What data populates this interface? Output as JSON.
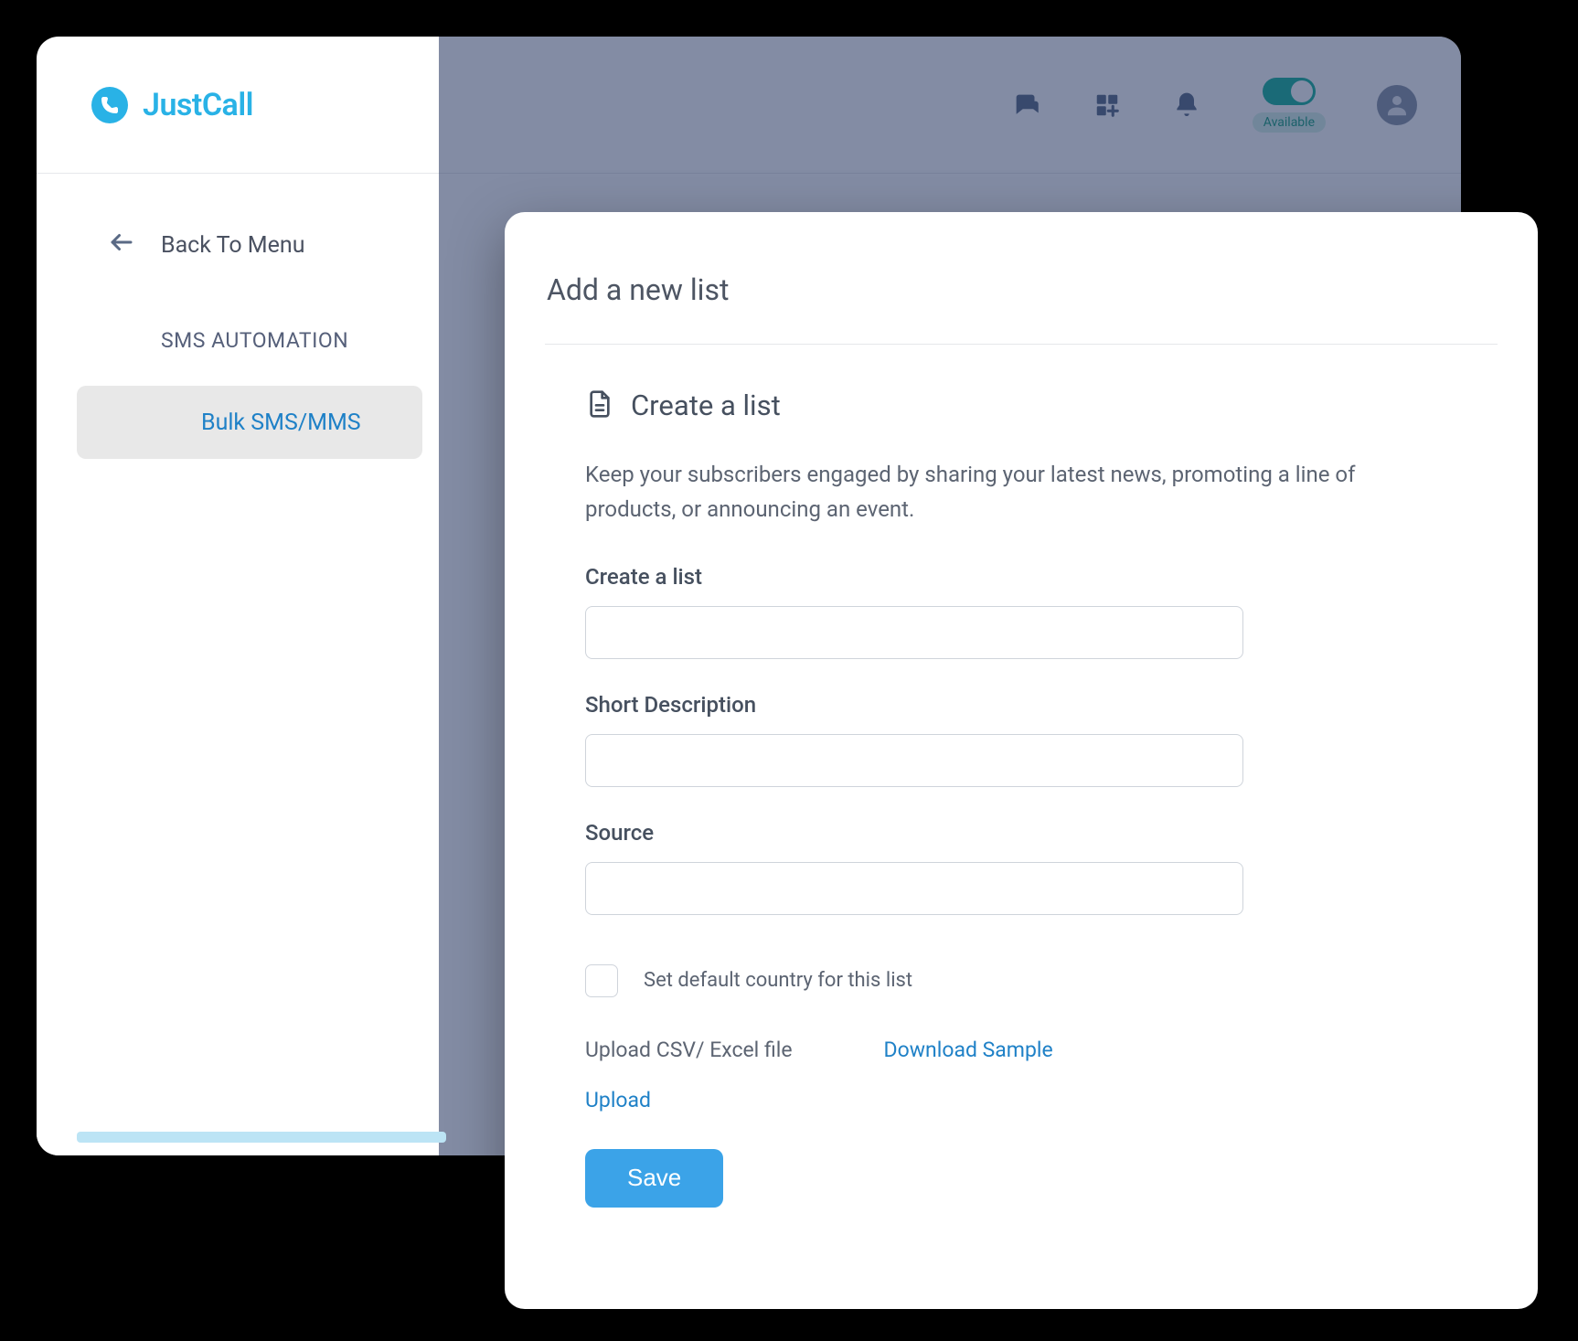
{
  "brand": {
    "name": "JustCall"
  },
  "header": {
    "availability_label": "Available"
  },
  "sidebar": {
    "back_label": "Back To Menu",
    "section_title": "SMS AUTOMATION",
    "active_item": "Bulk SMS/MMS"
  },
  "modal": {
    "title": "Add a new list",
    "create_title": "Create a list",
    "description": "Keep your subscribers engaged by sharing your latest news, promoting a line of products, or announcing an event.",
    "fields": {
      "create_label": "Create a list",
      "create_value": "",
      "desc_label": "Short Description",
      "desc_value": "",
      "source_label": "Source",
      "source_value": ""
    },
    "checkbox_label": "Set default country for this list",
    "upload_label": "Upload CSV/ Excel file",
    "download_sample": "Download Sample",
    "upload_link": "Upload",
    "save_label": "Save"
  }
}
